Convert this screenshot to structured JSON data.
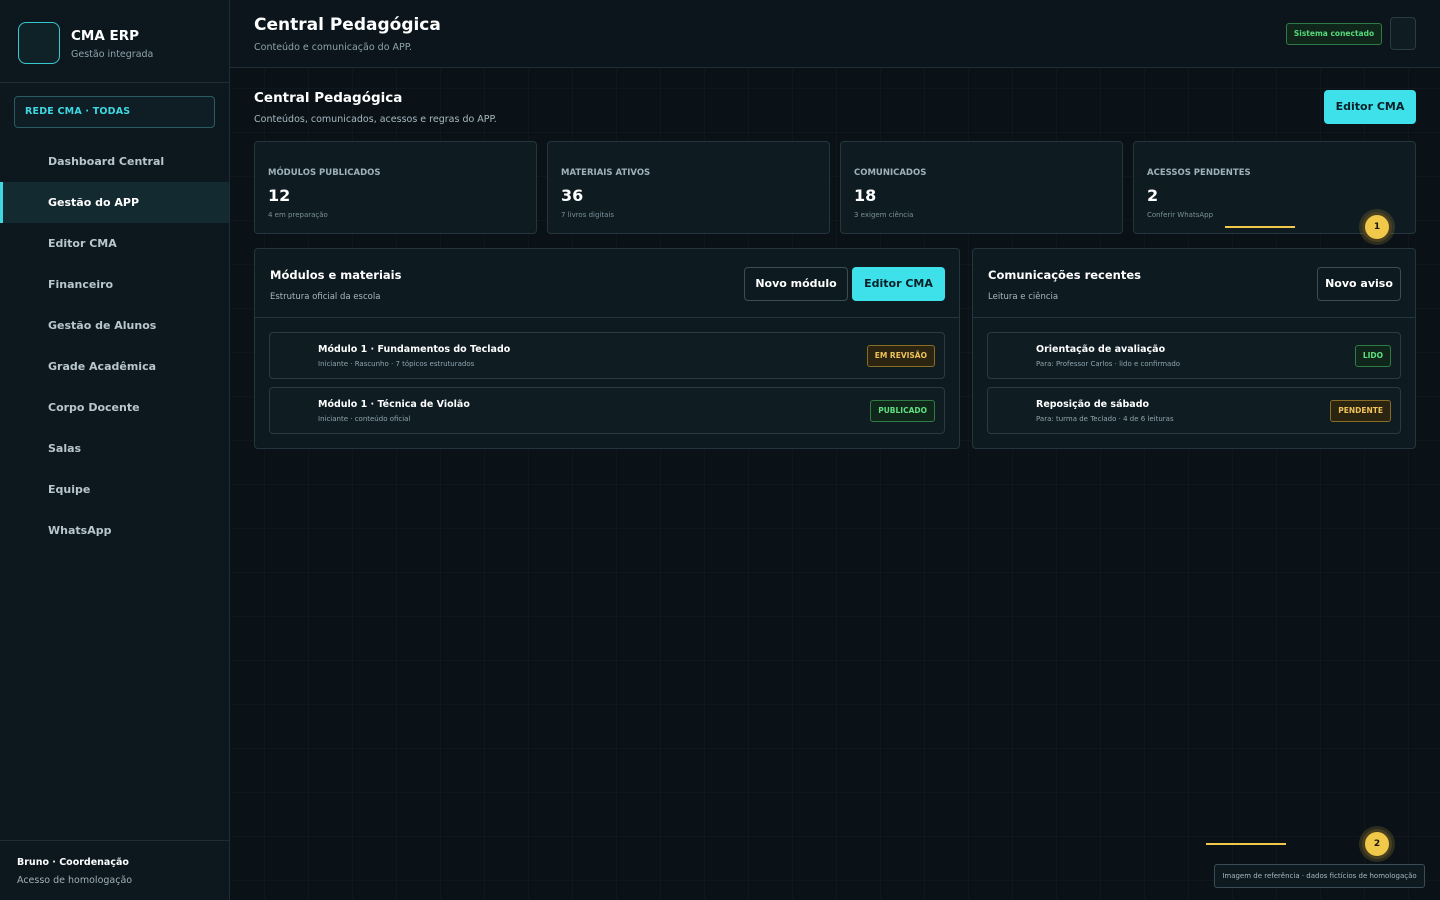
{
  "brand": {
    "title": "CMA ERP",
    "subtitle": "Gestão integrada"
  },
  "network_selector": {
    "label": "REDE CMA · TODAS"
  },
  "sidebar": {
    "items": [
      {
        "label": "Dashboard Central",
        "active": false
      },
      {
        "label": "Gestão do APP",
        "active": true
      },
      {
        "label": "Editor CMA",
        "active": false
      },
      {
        "label": "Financeiro",
        "active": false
      },
      {
        "label": "Gestão de Alunos",
        "active": false
      },
      {
        "label": "Grade Acadêmica",
        "active": false
      },
      {
        "label": "Corpo Docente",
        "active": false
      },
      {
        "label": "Salas",
        "active": false
      },
      {
        "label": "Equipe",
        "active": false
      },
      {
        "label": "WhatsApp",
        "active": false
      }
    ]
  },
  "user": {
    "name": "Bruno · Coordenação",
    "access": "Acesso de homologação"
  },
  "header": {
    "title": "Central Pedagógica",
    "subtitle": "Conteúdo e comunicação do APP.",
    "status": "Sistema conectado"
  },
  "section": {
    "title": "Central Pedagógica",
    "subtitle": "Conteúdos, comunicados, acessos e regras do APP.",
    "action_label": "Editor CMA"
  },
  "stats": [
    {
      "label": "MÓDULOS PUBLICADOS",
      "value": "12",
      "note": "4 em preparação"
    },
    {
      "label": "MATERIAIS ATIVOS",
      "value": "36",
      "note": "7 livros digitais"
    },
    {
      "label": "COMUNICADOS",
      "value": "18",
      "note": "3 exigem ciência"
    },
    {
      "label": "ACESSOS PENDENTES",
      "value": "2",
      "note": "Conferir WhatsApp"
    }
  ],
  "modules_panel": {
    "title": "Módulos e materiais",
    "subtitle": "Estrutura oficial da escola",
    "new_button": "Novo módulo",
    "editor_button": "Editor CMA",
    "rows": [
      {
        "title": "Módulo 1 · Fundamentos do Teclado",
        "meta": "Iniciante · Rascunho · 7 tópicos estruturados",
        "status": "EM REVISÃO"
      },
      {
        "title": "Módulo 1 · Técnica de Violão",
        "meta": "Iniciante · conteúdo oficial",
        "status": "PUBLICADO"
      }
    ]
  },
  "comms_panel": {
    "title": "Comunicações recentes",
    "subtitle": "Leitura e ciência",
    "new_button": "Novo aviso",
    "rows": [
      {
        "title": "Orientação de avaliação",
        "meta": "Para: Professor Carlos · lido e confirmado",
        "status": "LIDO"
      },
      {
        "title": "Reposição de sábado",
        "meta": "Para: turma de Teclado · 4 de 6 leituras",
        "status": "PENDENTE"
      }
    ]
  },
  "markers": [
    "1",
    "2"
  ],
  "footnote": "Imagem de referência · dados fictícios de homologação",
  "colors": {
    "accent": "#3ee0ea",
    "background": "#0a1218",
    "success": "#5ee080",
    "warning": "#f1c35a",
    "marker": "#f0c84a"
  }
}
